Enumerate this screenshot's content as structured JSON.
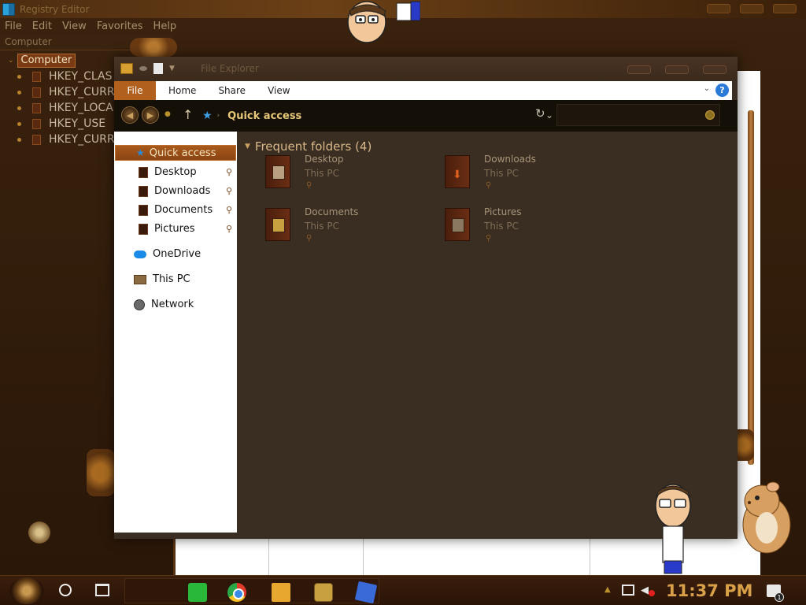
{
  "registry": {
    "title": "Registry Editor",
    "menu": [
      "File",
      "Edit",
      "View",
      "Favorites",
      "Help"
    ],
    "address": "Computer",
    "root": "Computer",
    "keys": [
      "HKEY_CLAS",
      "HKEY_CURR",
      "HKEY_LOCA",
      "HKEY_USE",
      "HKEY_CURR"
    ]
  },
  "explorer": {
    "title": "File Explorer",
    "ribbon": {
      "file": "File",
      "tabs": [
        "Home",
        "Share",
        "View"
      ],
      "help": "?"
    },
    "address": "Quick access",
    "nav": {
      "quick_access": "Quick access",
      "pinned": [
        "Desktop",
        "Downloads",
        "Documents",
        "Pictures"
      ],
      "onedrive": "OneDrive",
      "this_pc": "This PC",
      "network": "Network"
    },
    "group_header": "Frequent folders (4)",
    "folders": [
      {
        "name": "Desktop",
        "location": "This PC"
      },
      {
        "name": "Downloads",
        "location": "This PC"
      },
      {
        "name": "Documents",
        "location": "This PC"
      },
      {
        "name": "Pictures",
        "location": "This PC"
      }
    ]
  },
  "taskbar": {
    "clock": "11:37 PM",
    "notification_count": "1"
  },
  "colors": {
    "accent": "#b2601e",
    "clock": "#d8a048",
    "address_text": "#e8c878",
    "help_badge": "#2a7ad8"
  },
  "icons": [
    "regedit-icon",
    "folder-icon",
    "star-icon",
    "pin-icon",
    "onedrive-icon",
    "this-pc-icon",
    "network-icon",
    "refresh-icon",
    "search-icon",
    "start-button-icon",
    "cortana-icon",
    "task-view-icon",
    "sticky-notes-icon",
    "chrome-icon",
    "file-explorer-icon",
    "game-icon",
    "cubes-icon",
    "network-tray-icon",
    "volume-muted-icon",
    "action-center-icon"
  ]
}
